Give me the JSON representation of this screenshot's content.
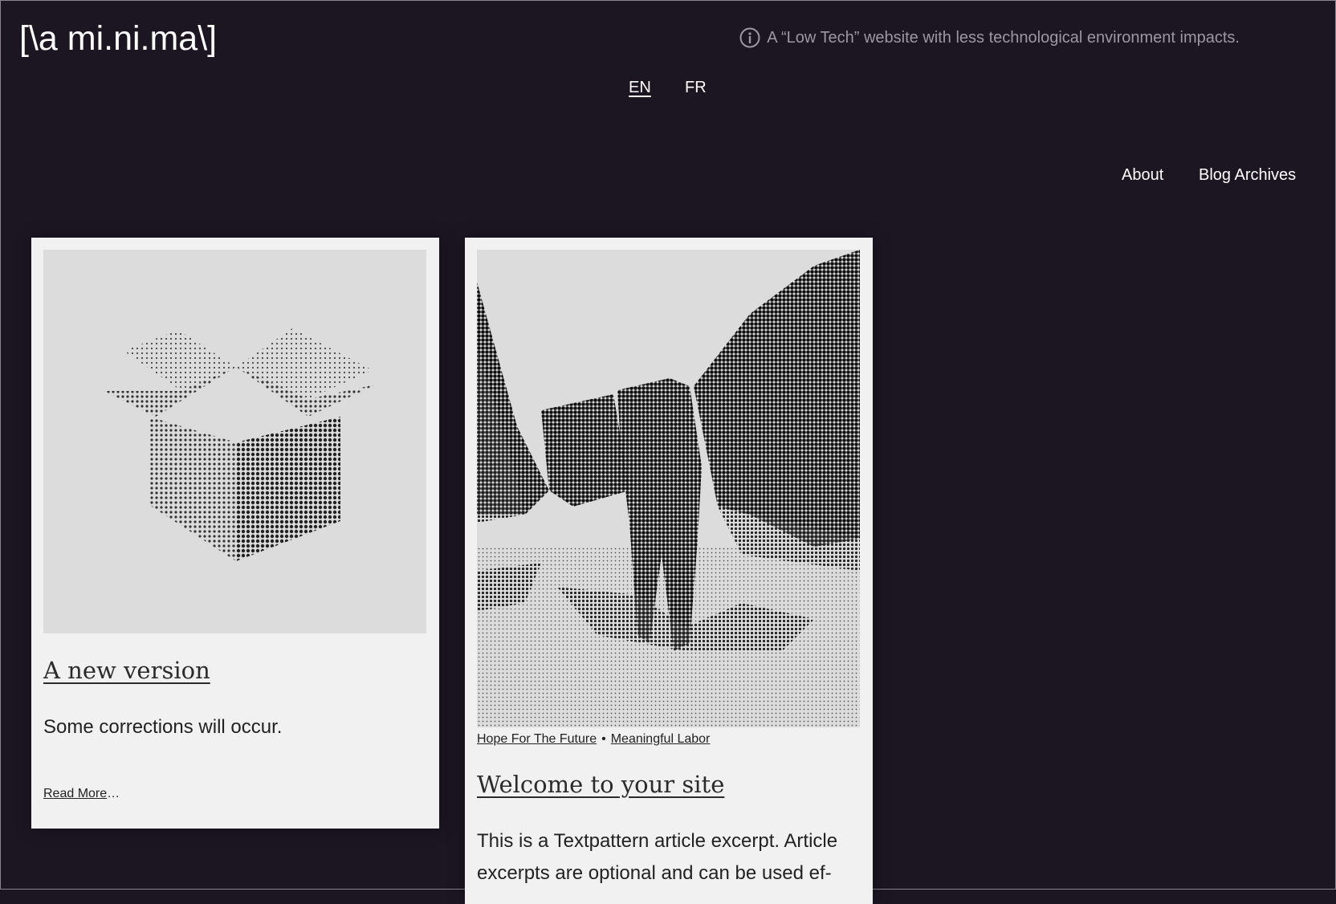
{
  "header": {
    "site_title": "[\\a mi.ni.ma\\]",
    "tagline": "A “Low Tech” website with less technological environment impacts.",
    "info_icon": "info-icon"
  },
  "languages": [
    {
      "label": "EN",
      "active": true
    },
    {
      "label": "FR",
      "active": false
    }
  ],
  "nav": {
    "about": "About",
    "archives": "Blog Archives"
  },
  "posts": [
    {
      "title": "A new version",
      "excerpt": "Some corrections will occur.",
      "read_more": "Read More",
      "read_more_suffix": "…",
      "image": "dithered-open-box-illustration"
    },
    {
      "categories": [
        "Hope For The Future",
        "Meaningful Labor"
      ],
      "separator": "•",
      "title": "Welcome to your site",
      "excerpt": "This is a Textpattern article excerpt. Article excerpts are optional and can be used ef-",
      "image": "dithered-person-walking-on-snow-photo"
    }
  ],
  "colors": {
    "background": "#1c1622",
    "card": "#f1f1f1",
    "text_light": "#ffffff",
    "tagline": "#9d97a4"
  }
}
